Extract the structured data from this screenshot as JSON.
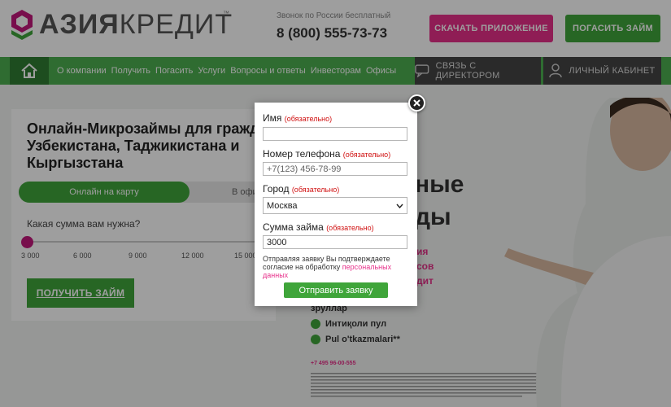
{
  "header": {
    "logo_bold": "АЗИЯ",
    "logo_thin": "КРЕДИТ",
    "logo_tm": "™",
    "phone_caption": "Звонок по России бесплатный",
    "phone_number": "8 (800) 555-73-73",
    "app_button": "СКАЧАТЬ ПРИЛОЖЕНИЕ",
    "repay_button": "ПОГАСИТЬ ЗАЙМ"
  },
  "nav": {
    "items": [
      {
        "label": "О компании"
      },
      {
        "label": "Получить"
      },
      {
        "label": "Погасить"
      },
      {
        "label": "Услуги"
      },
      {
        "label": "Вопросы и ответы"
      },
      {
        "label": "Инвесторам"
      },
      {
        "label": "Офисы"
      }
    ],
    "director": "СВЯЗЬ С ДИРЕКТОРОМ",
    "cabinet": "ЛИЧНЫЙ КАБИНЕТ"
  },
  "hero": {
    "title": "Онлайн-Микрозаймы для граждан Узбекистана, Таджикистана и Кыргызстана",
    "tab_active": "Онлайн на карту",
    "tab_other": "В офисе",
    "amount_question": "Какая сумма вам нужна?",
    "ticks": [
      "3 000",
      "6 000",
      "9 000",
      "12 000",
      "15 000"
    ],
    "get_button": "ПОЛУЧИТЬ ЗАЙМ",
    "promo_big_1": "ные",
    "promo_big_2": "ды",
    "promo_pink_1": "ия",
    "promo_pink_2": "сов",
    "promo_pink_3": "дит",
    "promo_line_1": "зруллар",
    "promo_line_2": "Интиқоли пул",
    "promo_line_3": "Pul o'tkazmalari**",
    "fine_phone": "+7 495 96-00-555"
  },
  "modal": {
    "name_label": "Имя",
    "phone_label": "Номер телефона",
    "city_label": "Город",
    "amount_label": "Сумма займа",
    "required": "(обязательно)",
    "name_value": "",
    "phone_placeholder": "+7(123) 456-78-99",
    "city_value": "Москва",
    "amount_value": "3000",
    "consent_text": "Отправляя заявку Вы подтверждаете согласие на обработку ",
    "consent_link": "персональных данных",
    "submit": "Отправить заявку"
  },
  "colors": {
    "brand_green": "#3fa53a",
    "brand_pink": "#e7308a",
    "nav_dark": "#444444"
  }
}
